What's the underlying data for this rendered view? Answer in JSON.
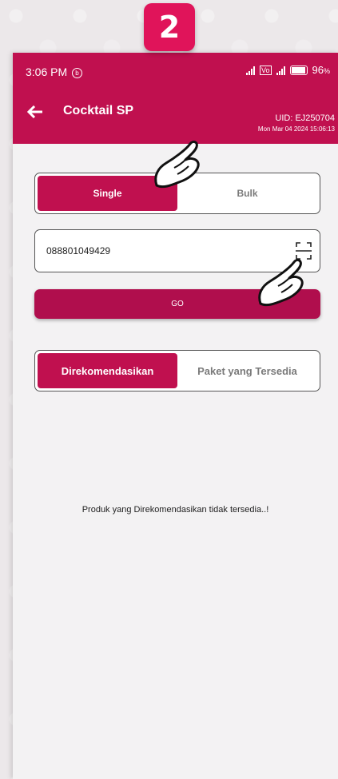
{
  "step_badge": "2",
  "status_bar": {
    "time": "3:06 PM",
    "notification_glyph": "⑥",
    "battery": "96",
    "battery_unit": "%"
  },
  "appbar": {
    "title": "Cocktail SP",
    "uid": "UID: EJ250704",
    "datetime": "Mon Mar 04 2024 15:06:13"
  },
  "mode_toggle": {
    "options": [
      "Single",
      "Bulk"
    ],
    "selected": "Single"
  },
  "phone_field": {
    "value": "088801049429"
  },
  "go_button": {
    "label": "GO"
  },
  "offer_tabs": {
    "options": [
      "Direkomendasikan",
      "Paket yang Tersedia"
    ],
    "selected": "Direkomendasikan"
  },
  "empty_message": "Produk yang Direkomendasikan tidak tersedia..!",
  "colors": {
    "brand": "#c0104f",
    "badge": "#e0145a",
    "background": "#f3f2f3"
  },
  "icons": [
    "back-arrow-icon",
    "barcode-scan-icon",
    "signal-icon",
    "battery-icon",
    "pointing-hand-icon"
  ]
}
